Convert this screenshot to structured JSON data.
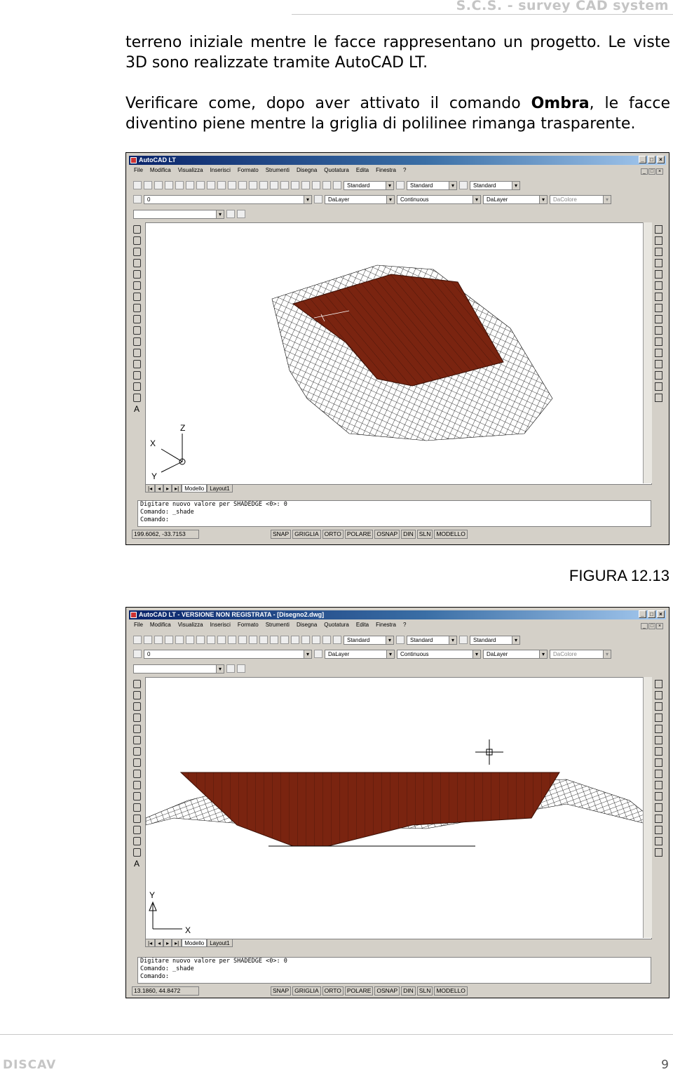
{
  "header": {
    "text": "S.C.S. -  survey CAD system"
  },
  "intro": {
    "line1": "terreno iniziale mentre le facce rappresentano un progetto. Le viste",
    "line2": "3D sono realizzate tramite AutoCAD LT.",
    "p2_before": "Verificare come, dopo aver attivato il comando ",
    "p2_bold": "Ombra",
    "p2_after": ", le facce",
    "p2_line2": "diventino piene mentre la griglia di polilinee rimanga trasparente."
  },
  "menu": [
    "File",
    "Modifica",
    "Visualizza",
    "Inserisci",
    "Formato",
    "Strumenti",
    "Disegna",
    "Quotatura",
    "Edita",
    "Finestra",
    "?"
  ],
  "toolbar": {
    "style1": "Standard",
    "style2": "Standard",
    "style3": "Standard",
    "layer": "0",
    "color": "DaLayer",
    "linetype": "Continuous",
    "lineweight": "DaLayer",
    "plotstyle": "DaColore"
  },
  "tabs": {
    "model": "Modello",
    "layout": "Layout1"
  },
  "status_buttons": [
    "SNAP",
    "GRIGLIA",
    "ORTO",
    "POLARE",
    "OSNAP",
    "DIN",
    "SLN",
    "MODELLO"
  ],
  "window1": {
    "title": "AutoCAD LT",
    "cmd1": "Digitare nuovo valore per SHADEDGE <0>: 0",
    "cmd2": "Comando: _shade",
    "cmd3": "Comando:",
    "coords": "199.6062, -33.7153",
    "ucs": {
      "z": "Z",
      "x": "X",
      "y": "Y"
    }
  },
  "caption": "FIGURA 12.13",
  "window2": {
    "title": "AutoCAD LT - VERSIONE NON REGISTRATA - [Disegno2.dwg]",
    "cmd1": "Digitare nuovo valore per SHADEDGE <0>: 0",
    "cmd2": "Comando: _shade",
    "cmd3": "Comando:",
    "coords": "13.1860, 44.8472",
    "ucs": {
      "y": "Y",
      "x": "X"
    }
  },
  "footer": {
    "left": "DISCAV",
    "page": "9"
  },
  "colors": {
    "shade": "#7a2410",
    "title_bar": "#0a246a",
    "chrome": "#d4d0c8"
  }
}
